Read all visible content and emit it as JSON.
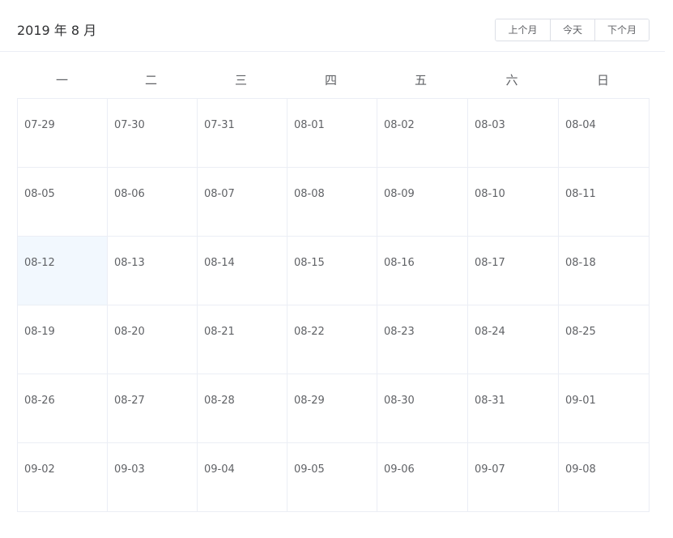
{
  "header": {
    "title": "2019 年 8 月",
    "prev_label": "上个月",
    "today_label": "今天",
    "next_label": "下个月"
  },
  "weekdays": [
    "一",
    "二",
    "三",
    "四",
    "五",
    "六",
    "日"
  ],
  "selected_date": "08-12",
  "colors": {
    "selected_bg": "#f2f8fe",
    "border": "#ebeef5",
    "text": "#606266"
  },
  "weeks": [
    [
      "07-29",
      "07-30",
      "07-31",
      "08-01",
      "08-02",
      "08-03",
      "08-04"
    ],
    [
      "08-05",
      "08-06",
      "08-07",
      "08-08",
      "08-09",
      "08-10",
      "08-11"
    ],
    [
      "08-12",
      "08-13",
      "08-14",
      "08-15",
      "08-16",
      "08-17",
      "08-18"
    ],
    [
      "08-19",
      "08-20",
      "08-21",
      "08-22",
      "08-23",
      "08-24",
      "08-25"
    ],
    [
      "08-26",
      "08-27",
      "08-28",
      "08-29",
      "08-30",
      "08-31",
      "09-01"
    ],
    [
      "09-02",
      "09-03",
      "09-04",
      "09-05",
      "09-06",
      "09-07",
      "09-08"
    ]
  ]
}
